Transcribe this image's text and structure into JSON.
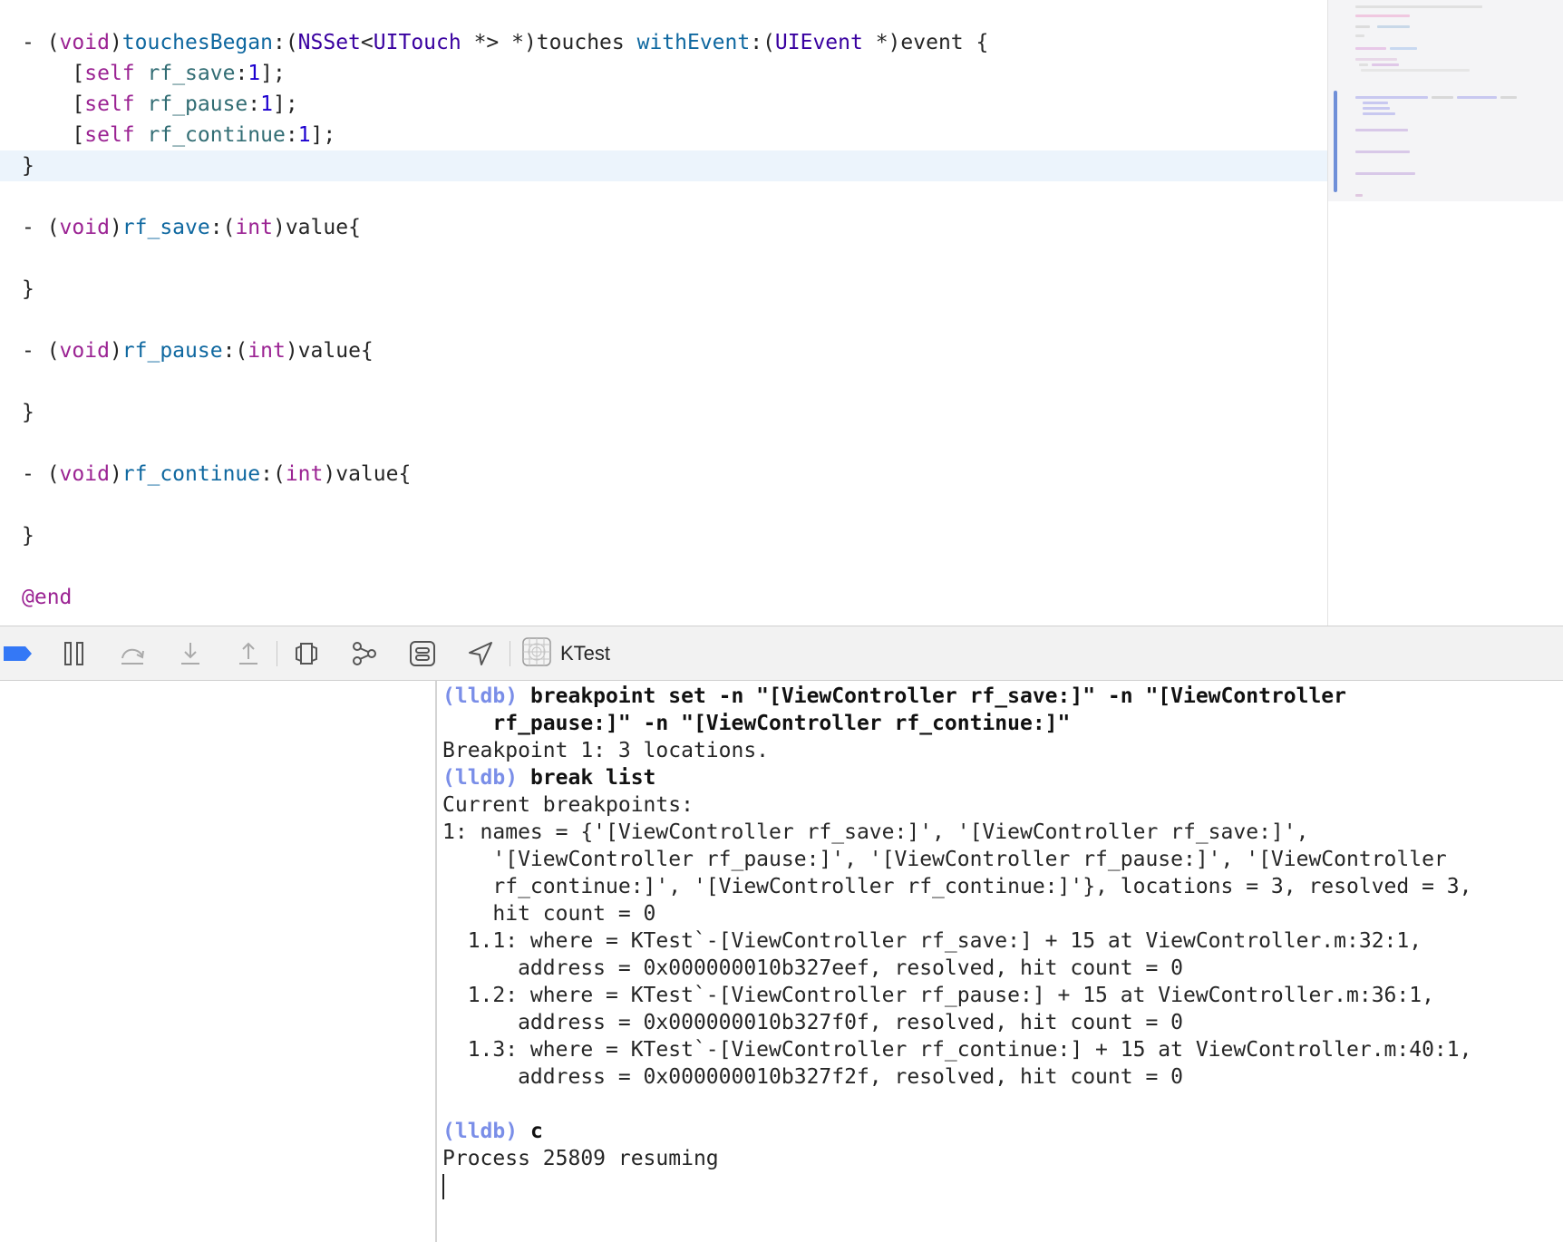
{
  "editor": {
    "lines": [
      {
        "segments": [
          {
            "t": "- (",
            "c": ""
          },
          {
            "t": "void",
            "c": "kw"
          },
          {
            "t": ")",
            "c": ""
          },
          {
            "t": "touchesBegan",
            "c": "decl"
          },
          {
            "t": ":(",
            "c": ""
          },
          {
            "t": "NSSet",
            "c": "typ"
          },
          {
            "t": "<",
            "c": ""
          },
          {
            "t": "UITouch",
            "c": "typ"
          },
          {
            "t": " *> *)touches ",
            "c": ""
          },
          {
            "t": "withEvent",
            "c": "decl"
          },
          {
            "t": ":(",
            "c": ""
          },
          {
            "t": "UIEvent",
            "c": "typ"
          },
          {
            "t": " *)event {",
            "c": ""
          }
        ]
      },
      {
        "segments": [
          {
            "t": "    [",
            "c": ""
          },
          {
            "t": "self",
            "c": "kw"
          },
          {
            "t": " ",
            "c": ""
          },
          {
            "t": "rf_save",
            "c": "fn"
          },
          {
            "t": ":",
            "c": ""
          },
          {
            "t": "1",
            "c": "num"
          },
          {
            "t": "];",
            "c": ""
          }
        ]
      },
      {
        "segments": [
          {
            "t": "    [",
            "c": ""
          },
          {
            "t": "self",
            "c": "kw"
          },
          {
            "t": " ",
            "c": ""
          },
          {
            "t": "rf_pause",
            "c": "fn"
          },
          {
            "t": ":",
            "c": ""
          },
          {
            "t": "1",
            "c": "num"
          },
          {
            "t": "];",
            "c": ""
          }
        ]
      },
      {
        "segments": [
          {
            "t": "    [",
            "c": ""
          },
          {
            "t": "self",
            "c": "kw"
          },
          {
            "t": " ",
            "c": ""
          },
          {
            "t": "rf_continue",
            "c": "fn"
          },
          {
            "t": ":",
            "c": ""
          },
          {
            "t": "1",
            "c": "num"
          },
          {
            "t": "];",
            "c": ""
          }
        ]
      },
      {
        "segments": [
          {
            "t": "}",
            "c": ""
          }
        ],
        "current": true
      },
      {
        "segments": []
      },
      {
        "segments": [
          {
            "t": "- (",
            "c": ""
          },
          {
            "t": "void",
            "c": "kw"
          },
          {
            "t": ")",
            "c": ""
          },
          {
            "t": "rf_save",
            "c": "decl"
          },
          {
            "t": ":(",
            "c": ""
          },
          {
            "t": "int",
            "c": "kw"
          },
          {
            "t": ")value{",
            "c": ""
          }
        ]
      },
      {
        "segments": []
      },
      {
        "segments": [
          {
            "t": "}",
            "c": ""
          }
        ]
      },
      {
        "segments": []
      },
      {
        "segments": [
          {
            "t": "- (",
            "c": ""
          },
          {
            "t": "void",
            "c": "kw"
          },
          {
            "t": ")",
            "c": ""
          },
          {
            "t": "rf_pause",
            "c": "decl"
          },
          {
            "t": ":(",
            "c": ""
          },
          {
            "t": "int",
            "c": "kw"
          },
          {
            "t": ")value{",
            "c": ""
          }
        ]
      },
      {
        "segments": []
      },
      {
        "segments": [
          {
            "t": "}",
            "c": ""
          }
        ]
      },
      {
        "segments": []
      },
      {
        "segments": [
          {
            "t": "- (",
            "c": ""
          },
          {
            "t": "void",
            "c": "kw"
          },
          {
            "t": ")",
            "c": ""
          },
          {
            "t": "rf_continue",
            "c": "decl"
          },
          {
            "t": ":(",
            "c": ""
          },
          {
            "t": "int",
            "c": "kw"
          },
          {
            "t": ")value{",
            "c": ""
          }
        ]
      },
      {
        "segments": []
      },
      {
        "segments": [
          {
            "t": "}",
            "c": ""
          }
        ]
      },
      {
        "segments": []
      },
      {
        "segments": [
          {
            "t": "@end",
            "c": "kw"
          }
        ]
      }
    ]
  },
  "debug_bar": {
    "target_label": "KTest",
    "icons": [
      "breakpoints-toggle-icon",
      "pause-icon",
      "step-over-icon",
      "step-into-icon",
      "step-out-icon",
      "view-hierarchy-icon",
      "memory-graph-icon",
      "environment-overrides-icon",
      "location-icon",
      "app-target-icon"
    ]
  },
  "console": {
    "lines": [
      {
        "prompt": "(lldb) ",
        "text": "breakpoint set -n \"[ViewController rf_save:]\" -n \"[ViewController",
        "bold": true
      },
      {
        "prompt": "",
        "text": "    rf_pause:]\" -n \"[ViewController rf_continue:]\"",
        "bold": true
      },
      {
        "prompt": "",
        "text": "Breakpoint 1: 3 locations.",
        "bold": false
      },
      {
        "prompt": "(lldb) ",
        "text": "break list",
        "bold": true
      },
      {
        "prompt": "",
        "text": "Current breakpoints:",
        "bold": false
      },
      {
        "prompt": "",
        "text": "1: names = {'[ViewController rf_save:]', '[ViewController rf_save:]',",
        "bold": false
      },
      {
        "prompt": "",
        "text": "    '[ViewController rf_pause:]', '[ViewController rf_pause:]', '[ViewController",
        "bold": false
      },
      {
        "prompt": "",
        "text": "    rf_continue:]', '[ViewController rf_continue:]'}, locations = 3, resolved = 3,",
        "bold": false
      },
      {
        "prompt": "",
        "text": "    hit count = 0",
        "bold": false
      },
      {
        "prompt": "",
        "text": "  1.1: where = KTest`-[ViewController rf_save:] + 15 at ViewController.m:32:1,",
        "bold": false
      },
      {
        "prompt": "",
        "text": "      address = 0x000000010b327eef, resolved, hit count = 0",
        "bold": false
      },
      {
        "prompt": "",
        "text": "  1.2: where = KTest`-[ViewController rf_pause:] + 15 at ViewController.m:36:1,",
        "bold": false
      },
      {
        "prompt": "",
        "text": "      address = 0x000000010b327f0f, resolved, hit count = 0",
        "bold": false
      },
      {
        "prompt": "",
        "text": "  1.3: where = KTest`-[ViewController rf_continue:] + 15 at ViewController.m:40:1,",
        "bold": false
      },
      {
        "prompt": "",
        "text": "      address = 0x000000010b327f2f, resolved, hit count = 0",
        "bold": false
      },
      {
        "prompt": "",
        "text": "",
        "bold": false
      },
      {
        "prompt": "(lldb) ",
        "text": "c",
        "bold": true
      },
      {
        "prompt": "",
        "text": "Process 25809 resuming",
        "bold": false
      }
    ]
  },
  "colors": {
    "keyword": "#9b2393",
    "function": "#326d74",
    "type": "#3900a0",
    "number": "#1c00cf",
    "declaration": "#0f68a0",
    "prompt": "#7a8ee8",
    "breakpoint_accent": "#3478f6",
    "current_line": "#ecf4fc"
  }
}
